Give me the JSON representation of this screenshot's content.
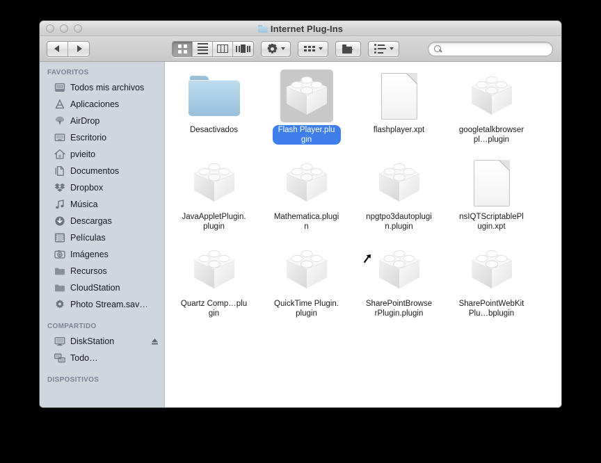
{
  "window": {
    "title": "Internet Plug-Ins",
    "title_icon": "folder-icon",
    "traffic_lights": [
      "close-button",
      "minimize-button",
      "zoom-button"
    ]
  },
  "toolbar": {
    "back_label": "◀",
    "forward_label": "▶",
    "view_modes": [
      {
        "name": "icon-view",
        "label": "Icon view",
        "active": true
      },
      {
        "name": "list-view",
        "label": "List view",
        "active": false
      },
      {
        "name": "column-view",
        "label": "Column view",
        "active": false
      },
      {
        "name": "coverflow-view",
        "label": "Cover Flow view",
        "active": false
      }
    ],
    "action_label": "Action",
    "arrange_label": "Arrange",
    "new_folder_label": "New Folder",
    "share_label": "Share"
  },
  "search": {
    "value": "",
    "placeholder": ""
  },
  "sidebar": {
    "sections": [
      {
        "header": "FAVORITOS",
        "items": [
          {
            "label": "Todos mis archivos",
            "icon": "all-files-icon"
          },
          {
            "label": "Aplicaciones",
            "icon": "applications-icon"
          },
          {
            "label": "AirDrop",
            "icon": "airdrop-icon"
          },
          {
            "label": "Escritorio",
            "icon": "desktop-icon"
          },
          {
            "label": "pvieito",
            "icon": "home-icon"
          },
          {
            "label": "Documentos",
            "icon": "documents-icon"
          },
          {
            "label": "Dropbox",
            "icon": "dropbox-icon"
          },
          {
            "label": "Música",
            "icon": "music-icon"
          },
          {
            "label": "Descargas",
            "icon": "downloads-icon"
          },
          {
            "label": "Películas",
            "icon": "movies-icon"
          },
          {
            "label": "Imágenes",
            "icon": "pictures-icon"
          },
          {
            "label": "Recursos",
            "icon": "folder-icon"
          },
          {
            "label": "CloudStation",
            "icon": "folder-icon"
          },
          {
            "label": "Photo Stream.sav…",
            "icon": "gear-icon"
          }
        ]
      },
      {
        "header": "COMPARTIDO",
        "items": [
          {
            "label": "DiskStation",
            "icon": "server-icon",
            "eject": true
          },
          {
            "label": "Todo…",
            "icon": "network-icon"
          }
        ]
      },
      {
        "header": "DISPOSITIVOS",
        "items": []
      }
    ]
  },
  "files": [
    {
      "name": "Desactivados",
      "kind": "folder",
      "selected": false
    },
    {
      "name": "Flash Player.plugin",
      "kind": "plugin",
      "selected": true
    },
    {
      "name": "flashplayer.xpt",
      "kind": "document",
      "selected": false
    },
    {
      "name": "googletalkbrowserpl…plugin",
      "kind": "plugin",
      "selected": false
    },
    {
      "name": "JavaAppletPlugin.plugin",
      "kind": "plugin",
      "selected": false
    },
    {
      "name": "Mathematica.plugin",
      "kind": "plugin",
      "selected": false
    },
    {
      "name": "npgtpo3dautoplugin.plugin",
      "kind": "plugin",
      "selected": false
    },
    {
      "name": "nsIQTScriptablePlugin.xpt",
      "kind": "document",
      "selected": false
    },
    {
      "name": "Quartz Comp…plugin",
      "kind": "plugin",
      "selected": false
    },
    {
      "name": "QuickTime Plugin.plugin",
      "kind": "plugin",
      "selected": false
    },
    {
      "name": "SharePointBrowserPlugin.plugin",
      "kind": "plugin",
      "selected": false
    },
    {
      "name": "SharePointWebKitPlu…bplugin",
      "kind": "plugin",
      "selected": false
    }
  ],
  "colors": {
    "selection_blue": "#3d7eea",
    "sidebar_bg": "#d0d6de",
    "sidebar_header": "#7c8292",
    "content_bg": "#ffffff",
    "desktop_bg": "#000000"
  },
  "cursor": {
    "type": "alias-arrow-cursor"
  }
}
